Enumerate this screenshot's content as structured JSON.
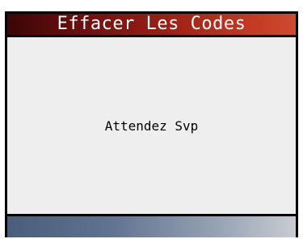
{
  "screen": {
    "title": "Effacer Les Codes",
    "message": "Attendez Svp"
  },
  "colors": {
    "frame": "#000000",
    "title_bar_start": "#3a0606",
    "title_bar_end": "#cf4a30",
    "content_background": "#eeeeee",
    "bottom_bar_start": "#4a5d7a",
    "bottom_bar_end": "#c8ccd2"
  }
}
